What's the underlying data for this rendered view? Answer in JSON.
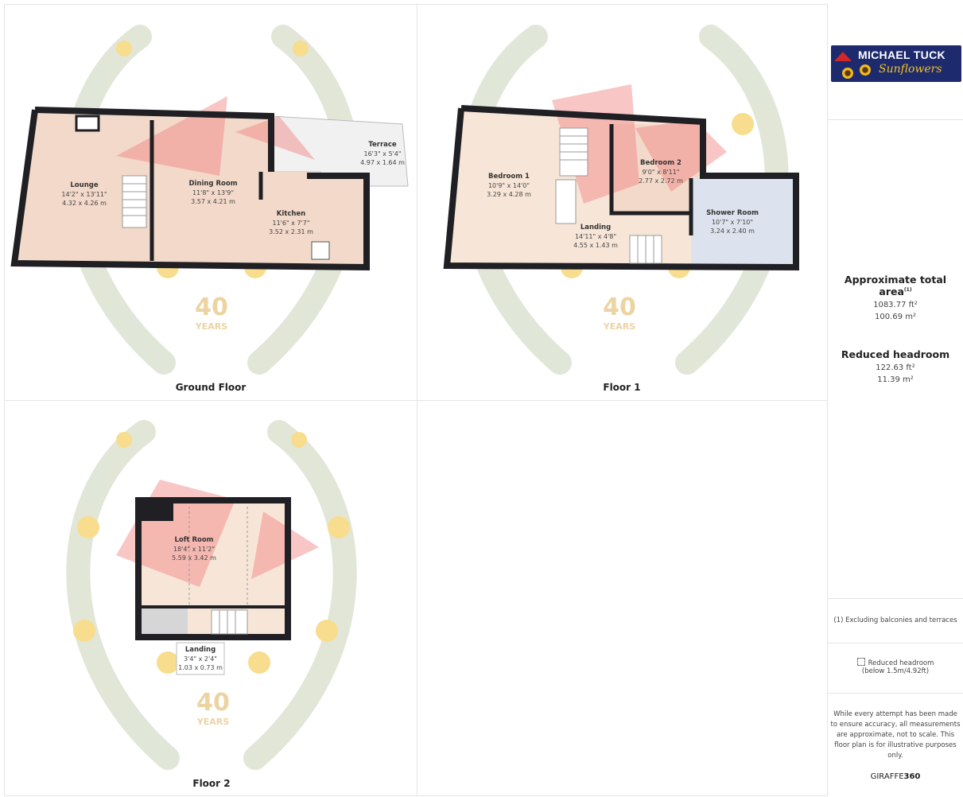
{
  "floors": {
    "ground": {
      "label": "Ground Floor",
      "rooms": [
        {
          "name": "Lounge",
          "dim_imperial": "14'2\" x 13'11\"",
          "dim_metric": "4.32 x 4.26 m"
        },
        {
          "name": "Dining Room",
          "dim_imperial": "11'8\" x 13'9\"",
          "dim_metric": "3.57 x 4.21 m"
        },
        {
          "name": "Kitchen",
          "dim_imperial": "11'6\" x 7'7\"",
          "dim_metric": "3.52 x 2.31 m"
        },
        {
          "name": "Terrace",
          "dim_imperial": "16'3\" x 5'4\"",
          "dim_metric": "4.97 x 1.64 m"
        }
      ]
    },
    "floor1": {
      "label": "Floor 1",
      "rooms": [
        {
          "name": "Bedroom 1",
          "dim_imperial": "10'9\" x 14'0\"",
          "dim_metric": "3.29 x 4.28 m"
        },
        {
          "name": "Bedroom 2",
          "dim_imperial": "9'0\" x 8'11\"",
          "dim_metric": "2.77 x 2.72 m"
        },
        {
          "name": "Landing",
          "dim_imperial": "14'11\" x 4'8\"",
          "dim_metric": "4.55 x 1.43 m"
        },
        {
          "name": "Shower Room",
          "dim_imperial": "10'7\" x 7'10\"",
          "dim_metric": "3.24 x 2.40 m"
        }
      ]
    },
    "floor2": {
      "label": "Floor 2",
      "rooms": [
        {
          "name": "Loft Room",
          "dim_imperial": "18'4\" x 11'2\"",
          "dim_metric": "5.59 x 3.42 m"
        },
        {
          "name": "Landing",
          "dim_imperial": "3'4\" x 2'4\"",
          "dim_metric": "1.03 x 0.73 m"
        }
      ]
    }
  },
  "watermark": {
    "number": "40",
    "word": "YEARS"
  },
  "sidebar": {
    "logo_brand": "MICHAEL TUCK",
    "logo_sub": "Sunflowers",
    "total_area_title": "Approximate total area",
    "total_area_footnote": "(1)",
    "total_area_ft": "1083.77 ft²",
    "total_area_m": "100.69 m²",
    "reduced_title": "Reduced headroom",
    "reduced_ft": "122.63 ft²",
    "reduced_m": "11.39 m²",
    "footnote": "(1) Excluding balconies and terraces",
    "legend_line1": "Reduced headroom",
    "legend_line2": "(below 1.5m/4.92ft)",
    "disclaimer": "While every attempt has been made to ensure accuracy, all measurements are approximate, not to scale. This floor plan is for illustrative purposes only.",
    "brand_plain": "GIRAFFE",
    "brand_bold": "360"
  },
  "colors": {
    "wall": "#1f1f24",
    "room_fill": "#f3d9c9",
    "room_fill_light": "#f7e6d8",
    "camera_cone": "#f28080",
    "wreath": "#c9d3b8",
    "sunflower": "#f2c231",
    "watermark_text": "#e8c98a",
    "shower_fill": "#dde3ee",
    "terrace_fill": "#f1f1f1"
  }
}
